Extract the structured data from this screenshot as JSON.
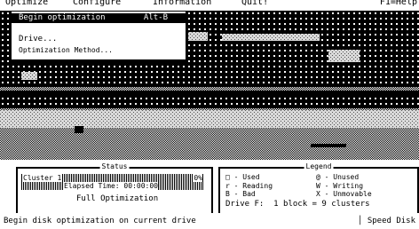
{
  "menubar": {
    "items": [
      "Optimize",
      "Configure",
      "Information",
      "Quit!"
    ],
    "help": "F1=Help"
  },
  "optimize_menu": {
    "items": [
      {
        "label": "Begin optimization",
        "shortcut": "Alt-B",
        "selected": true
      },
      {
        "label": "Drive...",
        "shortcut": "",
        "selected": false
      },
      {
        "label": "Optimization Method...",
        "shortcut": "",
        "selected": false
      }
    ]
  },
  "status": {
    "title": "Status",
    "cluster_label": "Cluster 1",
    "percent": "0%",
    "elapsed": "Elapsed Time: 00:00:00",
    "method": "Full Optimization"
  },
  "legend": {
    "title": "Legend",
    "items": [
      {
        "symbol": "□",
        "label": "- Used"
      },
      {
        "symbol": "@",
        "label": "- Unused"
      },
      {
        "symbol": "r",
        "label": "- Reading"
      },
      {
        "symbol": "W",
        "label": "- Writing"
      },
      {
        "symbol": "B",
        "label": "- Bad"
      },
      {
        "symbol": "X",
        "label": "- Unmovable"
      }
    ],
    "drive_line": "Drive F:  1 block = 9 clusters"
  },
  "status_bar": {
    "left": "Begin disk optimization on current drive",
    "right": "Speed Disk"
  },
  "colors": {
    "used_block": "#000000",
    "unused_block": "#ffffff",
    "dither_light": "#bdbdbd",
    "background": "#ffffff"
  }
}
